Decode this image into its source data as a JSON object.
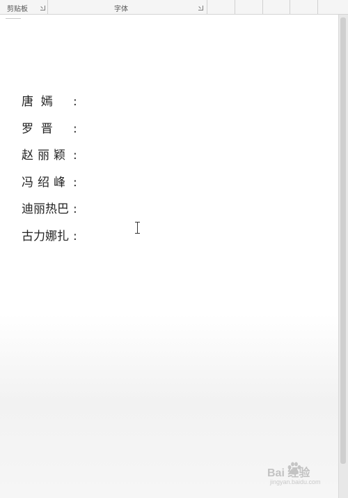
{
  "ribbon": {
    "groups": [
      {
        "label": "剪贴板"
      },
      {
        "label": "字体"
      }
    ]
  },
  "document": {
    "names": [
      {
        "text": "唐  嫣",
        "colon": ":"
      },
      {
        "text": "罗  晋",
        "colon": ":"
      },
      {
        "text": "赵丽颖",
        "colon": ":"
      },
      {
        "text": "冯绍峰",
        "colon": ":"
      },
      {
        "text": "迪丽热巴",
        "colon": ":"
      },
      {
        "text": "古力娜扎",
        "colon": ":"
      }
    ]
  },
  "watermark": {
    "brand": "Bai 经验",
    "url": "jingyan.baidu.com"
  },
  "icons": {
    "clipboard_launcher": "dialog-launcher-icon",
    "font_launcher": "dialog-launcher-icon",
    "cursor": "text-cursor-icon",
    "watermark_logo": "baidu-paw-icon"
  }
}
